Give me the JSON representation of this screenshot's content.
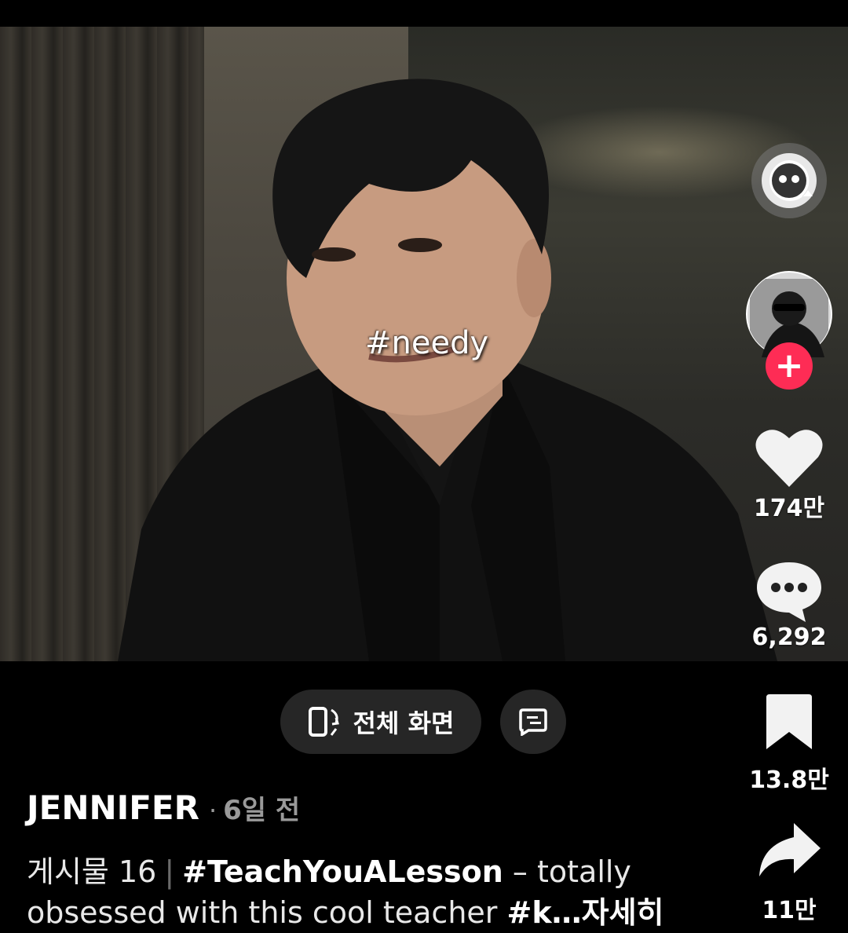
{
  "video": {
    "overlay_text": "#needy"
  },
  "rail": {
    "avatar_follow_symbol": "+",
    "like_count": "174만",
    "comment_count": "6,292",
    "bookmark_count": "13.8만",
    "share_count": "11만"
  },
  "actions": {
    "fullscreen_label": "전체 화면"
  },
  "post": {
    "author": "JENNIFER",
    "separator": "·",
    "time": "6일 전",
    "post_label": "게시물 16",
    "divider": "|",
    "hashtag1": "#TeachYouALesson",
    "caption_text": " – totally obsessed with this cool teacher ",
    "hashtag2": "#k…",
    "more_label": "자세히"
  },
  "colors": {
    "follow_accent": "#fe2c55",
    "pill_bg": "#262626",
    "muted_text": "#9a9a9a"
  },
  "icons": [
    "ai-chat-icon",
    "heart-icon",
    "comment-icon",
    "bookmark-icon",
    "share-icon",
    "fullscreen-icon",
    "caption-icon",
    "plus-icon"
  ]
}
